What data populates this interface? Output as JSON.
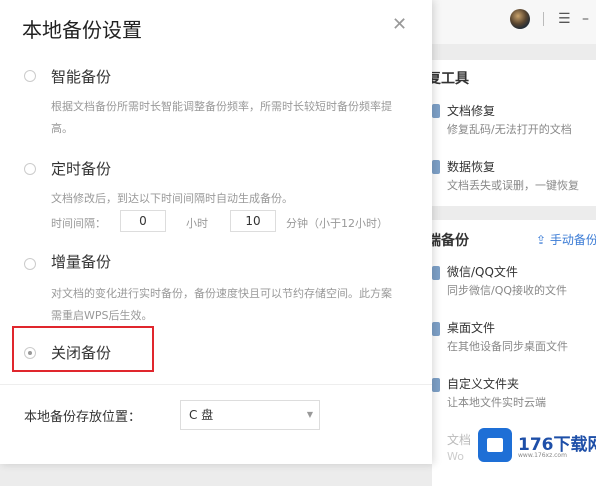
{
  "dialog": {
    "title": "本地备份设置",
    "close_icon": "close-icon",
    "options": [
      {
        "label": "智能备份",
        "desc": "根据文档备份所需时长智能调整备份频率，所需时长较短时备份频率提高。",
        "selected": false
      },
      {
        "label": "定时备份",
        "desc": "文档修改后，到达以下时间间隔时自动生成备份。",
        "selected": false
      },
      {
        "label": "增量备份",
        "desc": "对文档的变化进行实时备份，备份速度快且可以节约存储空间。此方案需重启WPS后生效。",
        "selected": false
      },
      {
        "label": "关闭备份",
        "desc": "",
        "selected": true
      }
    ],
    "interval": {
      "label": "时间间隔：",
      "hours_value": "0",
      "hours_unit": "小时",
      "minutes_value": "10",
      "minutes_unit": "分钟（小于12小时）"
    },
    "location": {
      "label": "本地备份存放位置：",
      "value": "C 盘"
    }
  },
  "background": {
    "tools_title": "复工具",
    "tools": [
      {
        "title": "文档修复",
        "desc": "修复乱码/无法打开的文档"
      },
      {
        "title": "数据恢复",
        "desc": "文档丢失或误删，一键恢复"
      }
    ],
    "backup_title": "端备份",
    "manual_backup": "手动备份",
    "items": [
      {
        "title": "微信/QQ文件",
        "desc": "同步微信/QQ接收的文件"
      },
      {
        "title": "桌面文件",
        "desc": "在其他设备同步桌面文件"
      },
      {
        "title": "自定义文件夹",
        "desc": "让本地文件实时云端"
      },
      {
        "title": "文档",
        "desc": "Wo"
      }
    ]
  },
  "watermark": {
    "text": "176下载网",
    "sub": "www.176xz.com"
  }
}
